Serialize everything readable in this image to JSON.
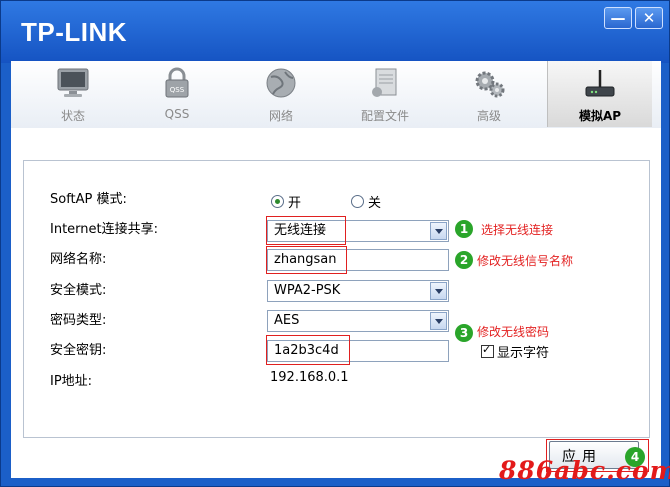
{
  "titlebar": {
    "brand": "TP-LINK",
    "min_glyph": "—",
    "close_glyph": "✕"
  },
  "nav": {
    "tabs": [
      {
        "label": "状态",
        "icon": "monitor-icon"
      },
      {
        "label": "QSS",
        "icon": "lock-icon"
      },
      {
        "label": "网络",
        "icon": "globe-icon"
      },
      {
        "label": "配置文件",
        "icon": "document-icon"
      },
      {
        "label": "高级",
        "icon": "gears-icon"
      },
      {
        "label": "模拟AP",
        "icon": "router-icon",
        "active": true
      }
    ]
  },
  "form": {
    "softap_label": "SoftAP 模式:",
    "radio_on": "开",
    "radio_off": "关",
    "sharing_label": "Internet连接共享:",
    "sharing_value": "无线连接",
    "ssid_label": "网络名称:",
    "ssid_value": "zhangsan",
    "security_label": "安全模式:",
    "security_value": "WPA2-PSK",
    "cipher_label": "密码类型:",
    "cipher_value": "AES",
    "key_label": "安全密钥:",
    "key_value": "1a2b3c4d",
    "show_chars_label": "显示字符",
    "ip_label": "IP地址:",
    "ip_value": "192.168.0.1"
  },
  "annotations": {
    "n1": "1",
    "t1": "选择无线连接",
    "n2": "2",
    "t2": "修改无线信号名称",
    "n3": "3",
    "t3": "修改无线密码",
    "n4": "4"
  },
  "apply_label": "应用",
  "watermark": "886abc.com",
  "colors": {
    "title_blue": "#1b5fc8",
    "annotation_red": "#e32222",
    "badge_green": "#2aa52a"
  }
}
